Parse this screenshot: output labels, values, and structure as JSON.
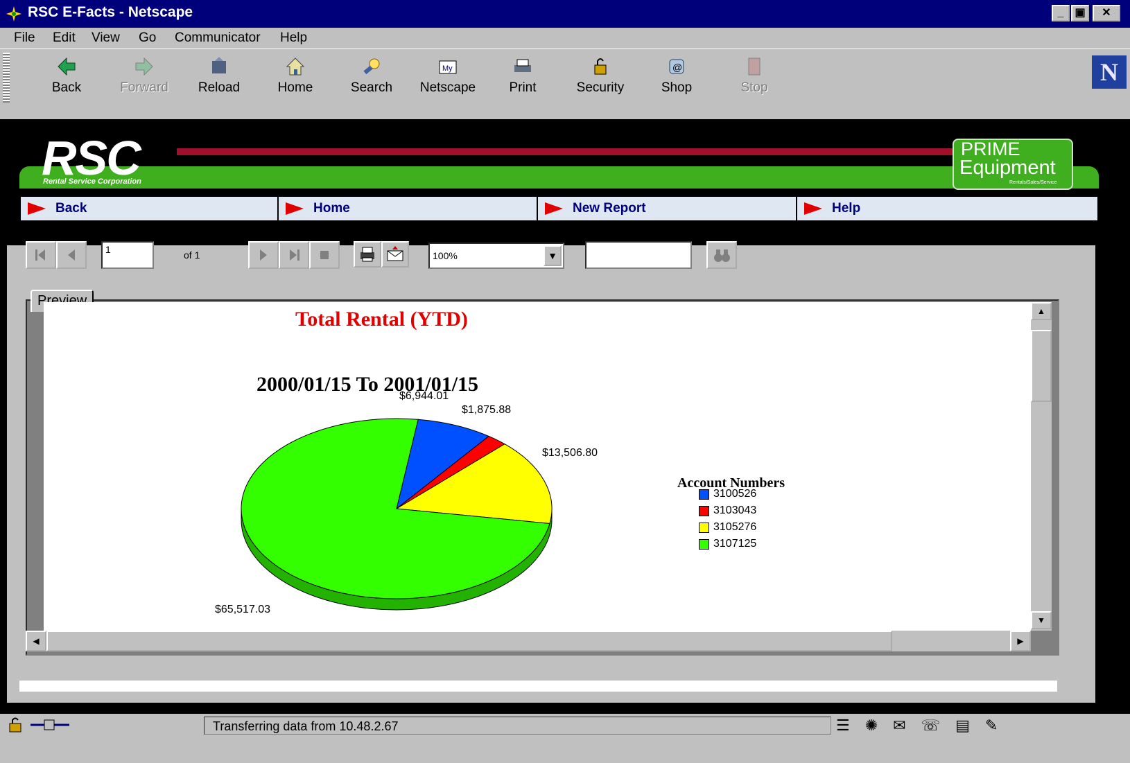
{
  "window": {
    "title": "RSC E-Facts - Netscape"
  },
  "menu": [
    "File",
    "Edit",
    "View",
    "Go",
    "Communicator",
    "Help"
  ],
  "toolbar": [
    {
      "label": "Back",
      "icon": "back-arrow-icon",
      "enabled": true
    },
    {
      "label": "Forward",
      "icon": "forward-arrow-icon",
      "enabled": false
    },
    {
      "label": "Reload",
      "icon": "reload-icon",
      "enabled": true
    },
    {
      "label": "Home",
      "icon": "home-icon",
      "enabled": true
    },
    {
      "label": "Search",
      "icon": "search-icon",
      "enabled": true
    },
    {
      "label": "Netscape",
      "icon": "my-netscape-icon",
      "enabled": true
    },
    {
      "label": "Print",
      "icon": "print-icon",
      "enabled": true
    },
    {
      "label": "Security",
      "icon": "security-lock-icon",
      "enabled": true
    },
    {
      "label": "Shop",
      "icon": "shop-icon",
      "enabled": true
    },
    {
      "label": "Stop",
      "icon": "stop-icon",
      "enabled": false
    }
  ],
  "branding": {
    "logo": "RSC",
    "logo_sub": "Rental Service Corporation",
    "prime_line1": "PRIME",
    "prime_line2": "Equipment",
    "prime_line3": "Rentals/Sales/Service"
  },
  "nav": [
    "Back",
    "Home",
    "New Report",
    "Help"
  ],
  "viewer": {
    "page_current": "1",
    "page_total": "of 1",
    "zoom": "100%",
    "search_value": "",
    "tab": "Preview"
  },
  "chart_data": {
    "type": "pie",
    "title": "Total Rental (YTD)",
    "subtitle": "2000/01/15 To 2001/01/15",
    "legend_title": "Account Numbers",
    "legend_placement": "right",
    "slices": [
      {
        "name": "3100526",
        "value": 6944.01,
        "label": "$6,944.01",
        "color": "#0050ff"
      },
      {
        "name": "3103043",
        "value": 1875.88,
        "label": "$1,875.88",
        "color": "#ff0000"
      },
      {
        "name": "3105276",
        "value": 13506.8,
        "label": "$13,506.80",
        "color": "#ffff00"
      },
      {
        "name": "3107125",
        "value": 65517.03,
        "label": "$65,517.03",
        "color": "#33ff00"
      }
    ]
  },
  "status": {
    "text": "Transferring data from 10.48.2.67"
  }
}
